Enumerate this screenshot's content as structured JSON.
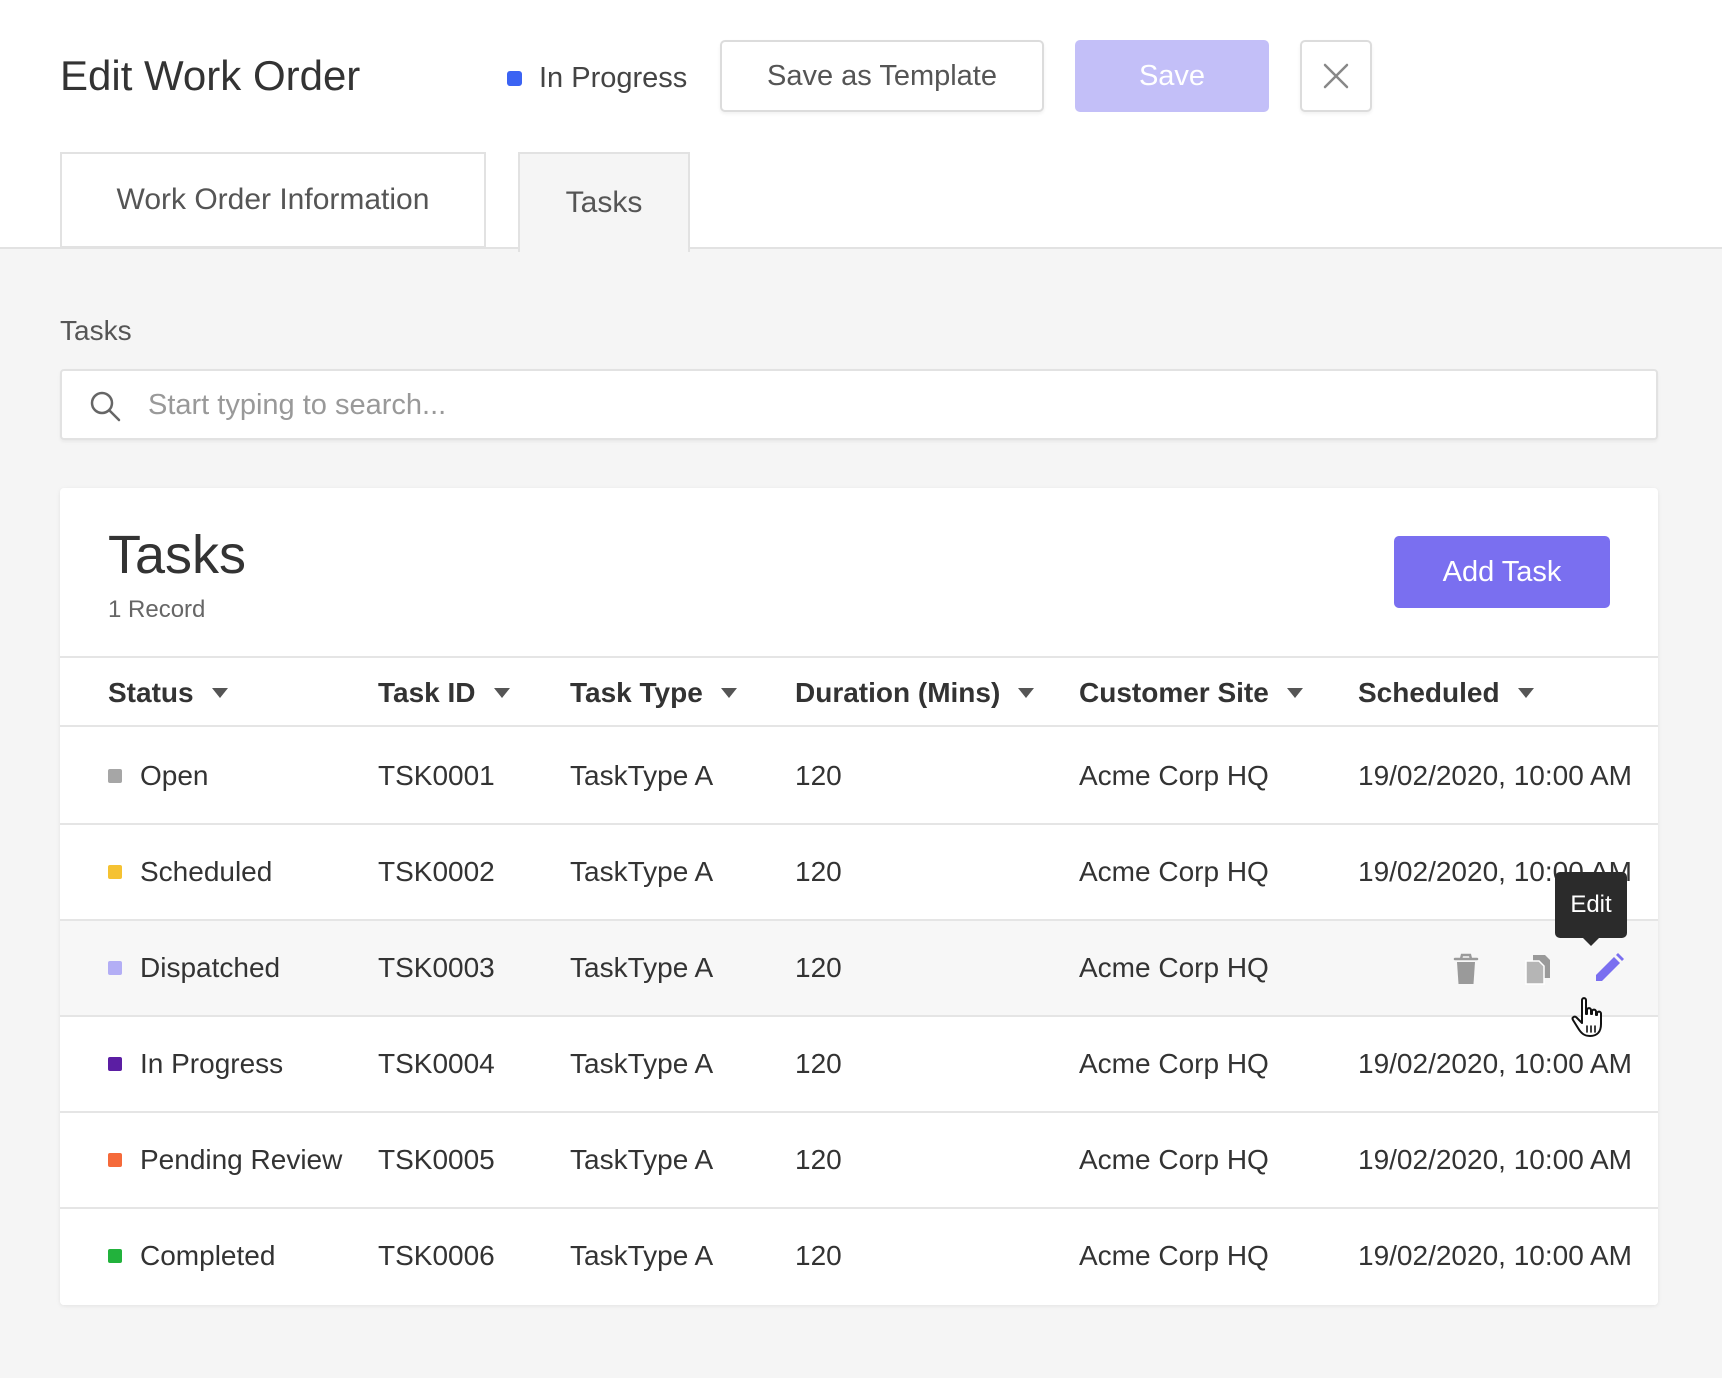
{
  "header": {
    "title": "Edit Work Order",
    "status": {
      "label": "In Progress",
      "color": "#3b63f3"
    },
    "save_template_label": "Save as Template",
    "save_label": "Save",
    "close_icon": "close-icon"
  },
  "tabs": [
    {
      "label": "Work Order Information",
      "active": false
    },
    {
      "label": "Tasks",
      "active": true
    }
  ],
  "section_label": "Tasks",
  "search": {
    "placeholder": "Start typing to search...",
    "value": ""
  },
  "card": {
    "title": "Tasks",
    "record_count": "1 Record",
    "add_label": "Add Task"
  },
  "table": {
    "columns": [
      "Status",
      "Task ID",
      "Task Type",
      "Duration (Mins)",
      "Customer Site",
      "Scheduled"
    ],
    "rows": [
      {
        "status": "Open",
        "status_color": "#a6a6a6",
        "task_id": "TSK0001",
        "task_type": "TaskType A",
        "duration": "120",
        "site": "Acme Corp HQ",
        "scheduled": "19/02/2020, 10:00 AM"
      },
      {
        "status": "Scheduled",
        "status_color": "#f5c232",
        "task_id": "TSK0002",
        "task_type": "TaskType A",
        "duration": "120",
        "site": "Acme Corp HQ",
        "scheduled": "19/02/2020, 10:00 AM"
      },
      {
        "status": "Dispatched",
        "status_color": "#b3aef5",
        "task_id": "TSK0003",
        "task_type": "TaskType A",
        "duration": "120",
        "site": "Acme Corp HQ",
        "scheduled": ""
      },
      {
        "status": "In Progress",
        "status_color": "#5b1ea3",
        "task_id": "TSK0004",
        "task_type": "TaskType A",
        "duration": "120",
        "site": "Acme Corp HQ",
        "scheduled": "19/02/2020, 10:00 AM"
      },
      {
        "status": "Pending Review",
        "status_color": "#f56a3a",
        "task_id": "TSK0005",
        "task_type": "TaskType A",
        "duration": "120",
        "site": "Acme Corp HQ",
        "scheduled": "19/02/2020, 10:00 AM"
      },
      {
        "status": "Completed",
        "status_color": "#22b23c",
        "task_id": "TSK0006",
        "task_type": "TaskType A",
        "duration": "120",
        "site": "Acme Corp HQ",
        "scheduled": "19/02/2020, 10:00 AM"
      }
    ],
    "row_actions": [
      "delete-icon",
      "copy-icon",
      "edit-icon"
    ]
  },
  "tooltip": "Edit",
  "colors": {
    "accent": "#7a6ff0",
    "accent_disabled": "#c3bff8"
  }
}
